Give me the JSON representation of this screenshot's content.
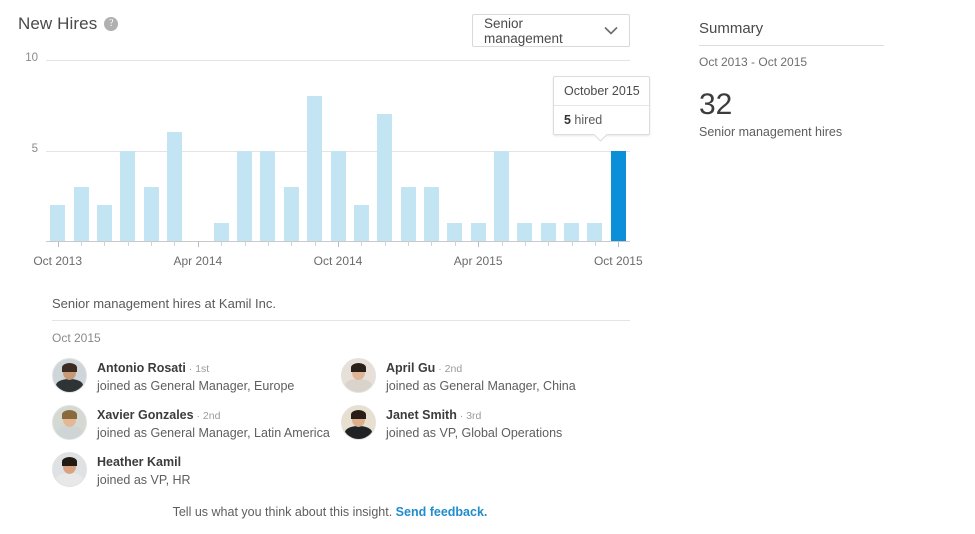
{
  "header": {
    "title": "New Hires",
    "help_icon": "question-mark-icon"
  },
  "filter": {
    "selected": "Senior management",
    "chevron_icon": "chevron-down-icon"
  },
  "tooltip": {
    "month": "October 2015",
    "count": "5",
    "unit": " hired"
  },
  "chart_data": {
    "type": "bar",
    "title": "New Hires",
    "xlabel": "",
    "ylabel": "",
    "ylim": [
      0,
      10
    ],
    "yticks": [
      5,
      10
    ],
    "ytick_labels": [
      "5",
      "10"
    ],
    "grid": true,
    "legend": null,
    "highlight_index": 24,
    "highlight_color": "#0a8fd8",
    "bar_color": "#c3e5f3",
    "axis_tick_labels": [
      "Oct 2013",
      "Apr 2014",
      "Oct 2014",
      "Apr 2015",
      "Oct 2015"
    ],
    "axis_tick_indices": [
      0,
      6,
      12,
      18,
      24
    ],
    "categories": [
      "Oct 2013",
      "Nov 2013",
      "Dec 2013",
      "Jan 2014",
      "Feb 2014",
      "Mar 2014",
      "Apr 2014",
      "May 2014",
      "Jun 2014",
      "Jul 2014",
      "Aug 2014",
      "Sep 2014",
      "Oct 2014",
      "Nov 2014",
      "Dec 2014",
      "Jan 2015",
      "Feb 2015",
      "Mar 2015",
      "Apr 2015",
      "May 2015",
      "Jun 2015",
      "Jul 2015",
      "Aug 2015",
      "Sep 2015",
      "Oct 2015"
    ],
    "values": [
      2,
      3,
      2,
      5,
      3,
      6,
      0,
      1,
      5,
      5,
      3,
      8,
      5,
      2,
      7,
      3,
      3,
      1,
      1,
      5,
      1,
      1,
      1,
      1,
      5
    ]
  },
  "list": {
    "title": "Senior management hires at Kamil Inc.",
    "month": "Oct 2015",
    "people": [
      {
        "name": "Antonio Rosati",
        "degree": "1st",
        "role": "joined as General Manager, Europe",
        "avatar": "avatar-antonio-rosati"
      },
      {
        "name": "April Gu",
        "degree": "2nd",
        "role": "joined as General Manager, China",
        "avatar": "avatar-april-gu"
      },
      {
        "name": "Xavier Gonzales",
        "degree": "2nd",
        "role": "joined as General Manager, Latin America",
        "avatar": "avatar-xavier-gonzales"
      },
      {
        "name": "Janet Smith",
        "degree": "3rd",
        "role": "joined as VP, Global Operations",
        "avatar": "avatar-janet-smith"
      },
      {
        "name": "Heather Kamil",
        "degree": "",
        "role": "joined as VP, HR",
        "avatar": "avatar-heather-kamil"
      }
    ]
  },
  "footer": {
    "text": "Tell us what you think about this insight.",
    "link": "Send feedback."
  },
  "summary": {
    "title": "Summary",
    "range": "Oct 2013 - Oct 2015",
    "number": "32",
    "caption": "Senior management hires"
  }
}
